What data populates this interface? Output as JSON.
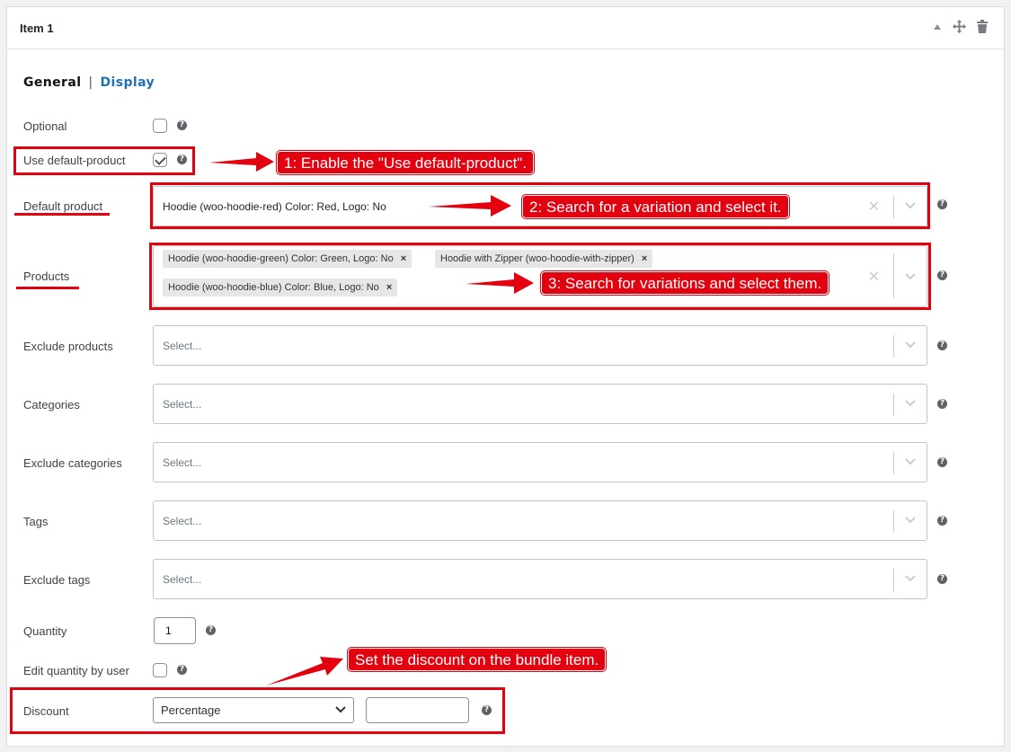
{
  "item": {
    "title": "Item 1"
  },
  "tabs": {
    "general": "General",
    "separator": "|",
    "display": "Display"
  },
  "fields": {
    "optional": {
      "label": "Optional",
      "checked": false
    },
    "use_default_product": {
      "label": "Use default-product",
      "checked": true
    },
    "default_product": {
      "label": "Default product",
      "value": "Hoodie (woo-hoodie-red) Color: Red, Logo: No"
    },
    "products": {
      "label": "Products",
      "tags": [
        "Hoodie (woo-hoodie-green) Color: Green, Logo: No",
        "Hoodie with Zipper (woo-hoodie-with-zipper)",
        "Hoodie (woo-hoodie-blue) Color: Blue, Logo: No"
      ]
    },
    "exclude_products": {
      "label": "Exclude products",
      "placeholder": "Select..."
    },
    "categories": {
      "label": "Categories",
      "placeholder": "Select..."
    },
    "exclude_categories": {
      "label": "Exclude categories",
      "placeholder": "Select..."
    },
    "tags": {
      "label": "Tags",
      "placeholder": "Select..."
    },
    "exclude_tags": {
      "label": "Exclude tags",
      "placeholder": "Select..."
    },
    "quantity": {
      "label": "Quantity",
      "value": "1"
    },
    "edit_quantity": {
      "label": "Edit quantity by user",
      "checked": false
    },
    "discount": {
      "label": "Discount",
      "type": "Percentage",
      "value": ""
    }
  },
  "annotations": {
    "step1": "1: Enable the \"Use default-product\".",
    "step2": "2: Search for a variation and select it.",
    "step3": "3: Search for variations and select them.",
    "discount_note": "Set the discount on the bundle item."
  },
  "colors": {
    "accent": "#2271b1",
    "annotation_red": "#e3000f"
  },
  "icons": {
    "collapse": "triangle-up-icon",
    "move": "move-icon",
    "delete": "trash-icon",
    "help": "help-icon",
    "clear": "clear-icon",
    "dropdown": "chevron-down-icon"
  }
}
